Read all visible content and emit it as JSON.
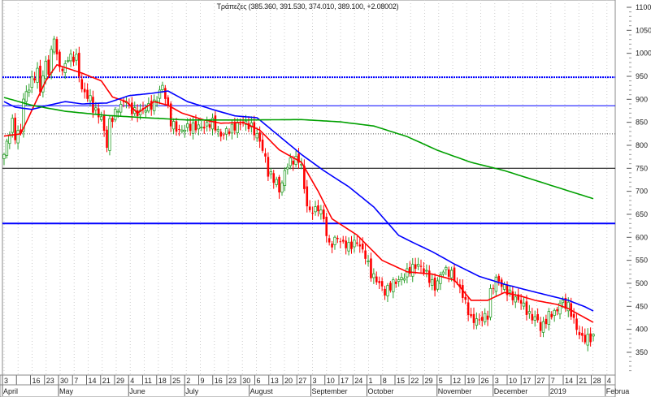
{
  "chart_data": {
    "type": "candlestick",
    "title": "Τράπεζες (385.360, 391.530, 374.010, 389.100, +2.08002)",
    "last_candle": {
      "open": 385.36,
      "high": 391.53,
      "low": 374.01,
      "close": 389.1,
      "change": 2.08002
    },
    "ylim": [
      320,
      1100
    ],
    "y_ticks": [
      350,
      400,
      450,
      500,
      550,
      600,
      650,
      700,
      750,
      800,
      850,
      900,
      950,
      1000,
      1050,
      1100
    ],
    "colors": {
      "up": "#2ca02c",
      "down": "#ff0000",
      "ma_short": "#ff0000",
      "ma_mid": "#0000ff",
      "ma_long": "#00a000"
    },
    "close_keypoints_by_trading_day": [
      [
        0,
        780
      ],
      [
        2,
        830
      ],
      [
        3,
        850
      ],
      [
        4,
        820
      ],
      [
        6,
        830
      ],
      [
        7,
        900
      ],
      [
        10,
        940
      ],
      [
        12,
        960
      ],
      [
        13,
        920
      ],
      [
        15,
        980
      ],
      [
        16,
        960
      ],
      [
        18,
        1040
      ],
      [
        19,
        990
      ],
      [
        21,
        960
      ],
      [
        23,
        990
      ],
      [
        26,
        990
      ],
      [
        28,
        920
      ],
      [
        31,
        900
      ],
      [
        32,
        880
      ],
      [
        35,
        860
      ],
      [
        37,
        800
      ],
      [
        38,
        850
      ],
      [
        41,
        880
      ],
      [
        44,
        900
      ],
      [
        45,
        880
      ],
      [
        48,
        870
      ],
      [
        51,
        880
      ],
      [
        54,
        890
      ],
      [
        57,
        930
      ],
      [
        59,
        880
      ],
      [
        60,
        850
      ],
      [
        63,
        830
      ],
      [
        66,
        840
      ],
      [
        69,
        840
      ],
      [
        72,
        840
      ],
      [
        75,
        850
      ],
      [
        78,
        820
      ],
      [
        80,
        830
      ],
      [
        83,
        840
      ],
      [
        86,
        850
      ],
      [
        89,
        840
      ],
      [
        92,
        810
      ],
      [
        94,
        770
      ],
      [
        95,
        740
      ],
      [
        98,
        720
      ],
      [
        99,
        700
      ],
      [
        102,
        760
      ],
      [
        105,
        770
      ],
      [
        107,
        760
      ],
      [
        108,
        700
      ],
      [
        110,
        650
      ],
      [
        111,
        660
      ],
      [
        114,
        660
      ],
      [
        116,
        610
      ],
      [
        117,
        580
      ],
      [
        120,
        600
      ],
      [
        121,
        590
      ],
      [
        124,
        580
      ],
      [
        127,
        590
      ],
      [
        130,
        560
      ],
      [
        132,
        520
      ],
      [
        135,
        500
      ],
      [
        137,
        480
      ],
      [
        140,
        500
      ],
      [
        143,
        510
      ],
      [
        146,
        530
      ],
      [
        149,
        540
      ],
      [
        152,
        520
      ],
      [
        155,
        490
      ],
      [
        158,
        530
      ],
      [
        161,
        520
      ],
      [
        164,
        490
      ],
      [
        167,
        440
      ],
      [
        168,
        420
      ],
      [
        171,
        420
      ],
      [
        174,
        430
      ],
      [
        175,
        480
      ],
      [
        177,
        510
      ],
      [
        180,
        490
      ],
      [
        183,
        470
      ],
      [
        186,
        460
      ],
      [
        189,
        430
      ],
      [
        192,
        420
      ],
      [
        193,
        400
      ],
      [
        196,
        430
      ],
      [
        199,
        440
      ],
      [
        200,
        460
      ],
      [
        203,
        450
      ],
      [
        205,
        420
      ],
      [
        206,
        400
      ],
      [
        208,
        380
      ],
      [
        211,
        380
      ],
      [
        212,
        389.1
      ]
    ],
    "moving_averages": [
      {
        "name": "short",
        "points": [
          [
            0,
            820
          ],
          [
            6,
            825
          ],
          [
            15,
            940
          ],
          [
            19,
            975
          ],
          [
            28,
            957
          ],
          [
            35,
            940
          ],
          [
            39,
            905
          ],
          [
            44,
            895
          ],
          [
            48,
            870
          ],
          [
            54,
            895
          ],
          [
            59,
            887
          ],
          [
            64,
            870
          ],
          [
            72,
            855
          ],
          [
            78,
            848
          ],
          [
            86,
            850
          ],
          [
            92,
            833
          ],
          [
            99,
            790
          ],
          [
            107,
            763
          ],
          [
            113,
            700
          ],
          [
            118,
            640
          ],
          [
            127,
            605
          ],
          [
            136,
            550
          ],
          [
            145,
            525
          ],
          [
            154,
            520
          ],
          [
            162,
            507
          ],
          [
            168,
            463
          ],
          [
            174,
            463
          ],
          [
            180,
            480
          ],
          [
            186,
            472
          ],
          [
            191,
            463
          ],
          [
            199,
            454
          ],
          [
            203,
            445
          ],
          [
            209,
            425
          ],
          [
            212,
            415
          ]
        ]
      },
      {
        "name": "mid",
        "points": [
          [
            0,
            895
          ],
          [
            4,
            883
          ],
          [
            10,
            878
          ],
          [
            16,
            887
          ],
          [
            22,
            895
          ],
          [
            28,
            890
          ],
          [
            37,
            892
          ],
          [
            45,
            908
          ],
          [
            53,
            913
          ],
          [
            59,
            918
          ],
          [
            66,
            895
          ],
          [
            75,
            878
          ],
          [
            83,
            864
          ],
          [
            91,
            860
          ],
          [
            98,
            825
          ],
          [
            107,
            780
          ],
          [
            115,
            745
          ],
          [
            124,
            710
          ],
          [
            133,
            666
          ],
          [
            142,
            604
          ],
          [
            148,
            586
          ],
          [
            154,
            569
          ],
          [
            162,
            542
          ],
          [
            171,
            515
          ],
          [
            180,
            498
          ],
          [
            189,
            484
          ],
          [
            197,
            472
          ],
          [
            203,
            463
          ],
          [
            209,
            449
          ],
          [
            212,
            440
          ]
        ]
      },
      {
        "name": "long",
        "points": [
          [
            0,
            904
          ],
          [
            10,
            887
          ],
          [
            22,
            874
          ],
          [
            37,
            865
          ],
          [
            51,
            860
          ],
          [
            66,
            855
          ],
          [
            86,
            855
          ],
          [
            107,
            856
          ],
          [
            121,
            851
          ],
          [
            133,
            842
          ],
          [
            145,
            819
          ],
          [
            156,
            789
          ],
          [
            168,
            763
          ],
          [
            180,
            745
          ],
          [
            191,
            724
          ],
          [
            203,
            701
          ],
          [
            212,
            684
          ]
        ]
      }
    ],
    "horizontal_lines": [
      {
        "value": 948,
        "color": "#0000ff",
        "style": "dotted-double"
      },
      {
        "value": 886,
        "color": "#0000ff",
        "style": "solid"
      },
      {
        "value": 825,
        "color": "#555555",
        "style": "dotted"
      },
      {
        "value": 750,
        "color": "#000000",
        "style": "solid"
      },
      {
        "value": 630,
        "color": "#0000ff",
        "style": "thick"
      }
    ],
    "x_week_labels": [
      "3",
      "",
      "16",
      "23",
      "30",
      "7",
      "14",
      "21",
      "29",
      "4",
      "11",
      "18",
      "25",
      "2",
      "9",
      "16",
      "23",
      "30",
      "6",
      "13",
      "20",
      "27",
      "3",
      "10",
      "17",
      "24",
      "1",
      "8",
      "15",
      "22",
      "29",
      "5",
      "12",
      "19",
      "26",
      "3",
      "10",
      "17",
      "27",
      "7",
      "14",
      "21",
      "28",
      "4"
    ],
    "x_month_labels": [
      {
        "label": "April",
        "week": 0
      },
      {
        "label": "May",
        "week": 4
      },
      {
        "label": "June",
        "week": 9
      },
      {
        "label": "July",
        "week": 13
      },
      {
        "label": "August",
        "week": 17.6
      },
      {
        "label": "September",
        "week": 22
      },
      {
        "label": "October",
        "week": 26
      },
      {
        "label": "November",
        "week": 31
      },
      {
        "label": "December",
        "week": 35
      },
      {
        "label": "2019",
        "week": 39
      },
      {
        "label": "Februa",
        "week": 43
      }
    ]
  }
}
